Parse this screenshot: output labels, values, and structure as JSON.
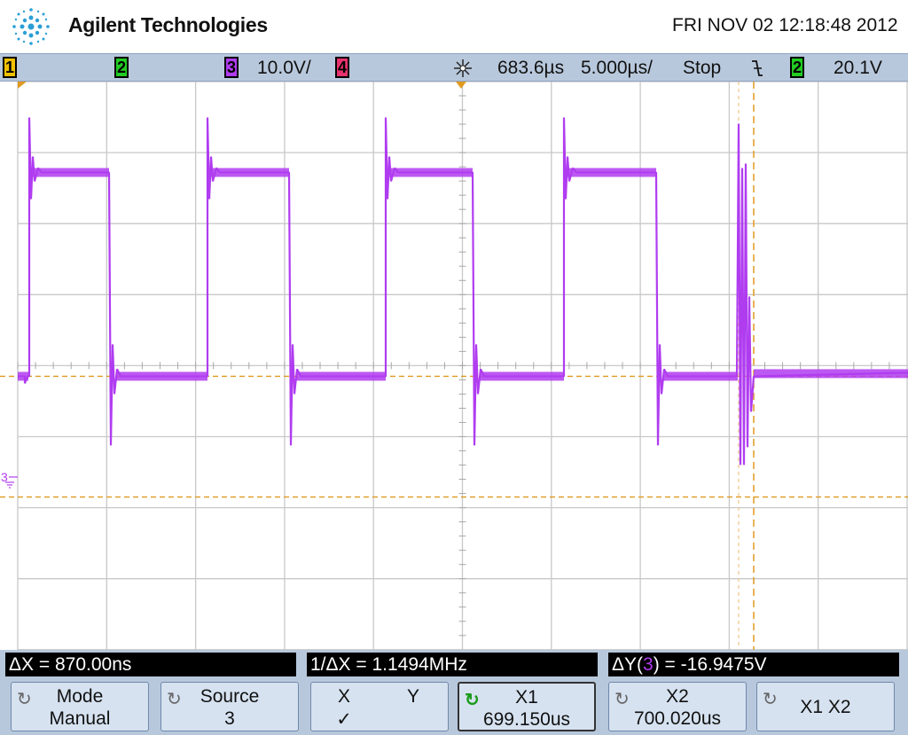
{
  "header": {
    "brand": "Agilent Technologies",
    "datetime": "FRI NOV 02 12:18:48 2012"
  },
  "status": {
    "ch1": "1",
    "ch2": "2",
    "ch3": "3",
    "ch3_scale": "10.0V/",
    "ch4": "4",
    "time_delay": "683.6µs",
    "time_scale": "5.000µs/",
    "run_state": "Stop",
    "trigger_slope_icon": "falling-edge-icon",
    "trigger_source": "2",
    "trigger_level": "20.1V"
  },
  "colors": {
    "ch1": "#f0c000",
    "ch2": "#22cc22",
    "ch3": "#b03cf0",
    "ch4": "#e8326e",
    "cursor": "#e09a20",
    "grid": "#c8c8c8",
    "panel": "#b8c8dc"
  },
  "measurements": {
    "dx": "ΔX = 870.00ns",
    "inv_dx": "1/ΔX = 1.1494MHz",
    "dy_prefix": "ΔY(",
    "dy_channel": "3",
    "dy_suffix": ") = -16.9475V"
  },
  "softkeys": {
    "mode_title": "Mode",
    "mode_value": "Manual",
    "source_title": "Source",
    "source_value": "3",
    "x_label": "X",
    "y_label": "Y",
    "check": "✓",
    "x1_title": "X1",
    "x1_value": "699.150us",
    "x2_title": "X2",
    "x2_value": "700.020us",
    "x1x2_label": "X1 X2"
  },
  "waveform": {
    "channel_marker": "3",
    "period_us": 10,
    "high_level_div": 2.72,
    "low_level_div": -0.15,
    "cursor_y1_div": -0.15,
    "cursor_y2_div": -1.85
  }
}
